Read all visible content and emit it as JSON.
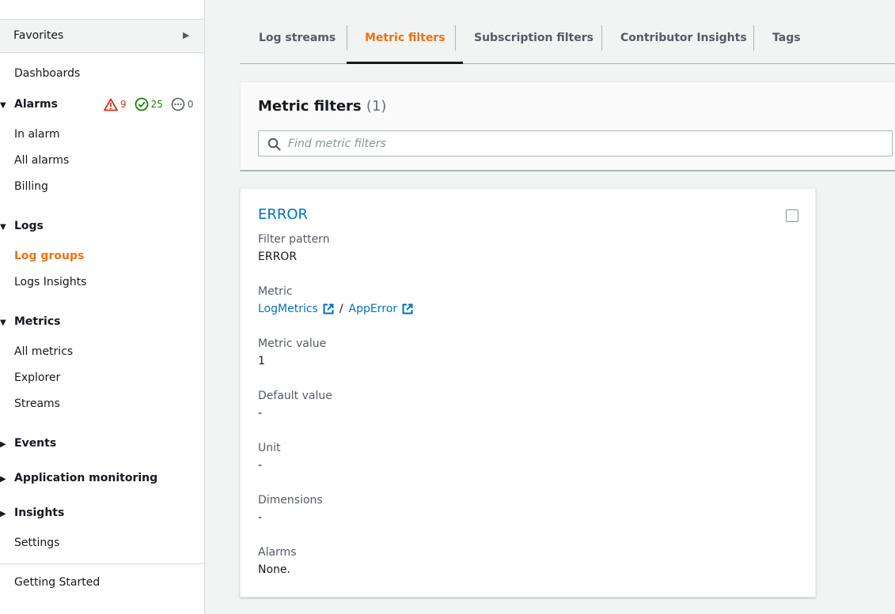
{
  "sidebar": {
    "favorites_label": "Favorites",
    "items": [
      {
        "key": "dashboards",
        "label": "Dashboards"
      },
      {
        "key": "in-alarm",
        "label": "In alarm"
      },
      {
        "key": "all-alarms",
        "label": "All alarms"
      },
      {
        "key": "billing",
        "label": "Billing"
      },
      {
        "key": "log-groups",
        "label": "Log groups"
      },
      {
        "key": "logs-insights",
        "label": "Logs Insights"
      },
      {
        "key": "all-metrics",
        "label": "All metrics"
      },
      {
        "key": "explorer",
        "label": "Explorer"
      },
      {
        "key": "streams",
        "label": "Streams"
      },
      {
        "key": "settings",
        "label": "Settings"
      },
      {
        "key": "getting-started",
        "label": "Getting Started"
      }
    ],
    "sections": {
      "alarms": "Alarms",
      "logs": "Logs",
      "metrics": "Metrics",
      "events": "Events",
      "application_monitoring": "Application monitoring",
      "insights": "Insights"
    },
    "alarm_counts": {
      "alarm": "9",
      "ok": "25",
      "insufficient": "0"
    },
    "active_item": "Log groups"
  },
  "tabs": [
    {
      "label": "Log streams"
    },
    {
      "label": "Metric filters"
    },
    {
      "label": "Subscription filters"
    },
    {
      "label": "Contributor Insights"
    },
    {
      "label": "Tags"
    }
  ],
  "active_tab": "Metric filters",
  "metric_filters": {
    "heading": "Metric filters",
    "count": "(1)",
    "search_placeholder": "Find metric filters"
  },
  "filter": {
    "name": "ERROR",
    "fields": {
      "filter_pattern_label": "Filter pattern",
      "filter_pattern_value": "ERROR",
      "metric_label": "Metric",
      "metric_namespace": "LogMetrics",
      "metric_separator": "/",
      "metric_name": "AppError",
      "metric_value_label": "Metric value",
      "metric_value": "1",
      "default_value_label": "Default value",
      "default_value": "-",
      "unit_label": "Unit",
      "unit_value": "-",
      "dimensions_label": "Dimensions",
      "dimensions_value": "-",
      "alarms_label": "Alarms",
      "alarms_value": "None."
    }
  },
  "colors": {
    "accent_orange": "#ec7211",
    "link_blue": "#0073bb",
    "alarm_red": "#d13212",
    "ok_green": "#1d8102"
  }
}
